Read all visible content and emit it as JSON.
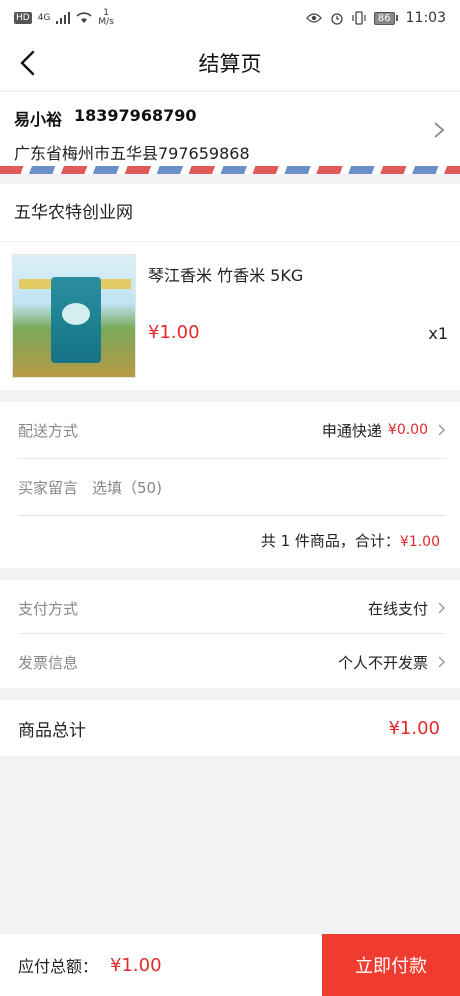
{
  "status_bar": {
    "hd": "HD",
    "network": "4G",
    "speed_value": "1",
    "speed_unit": "M/s",
    "battery": "86",
    "time": "11:03"
  },
  "header": {
    "title": "结算页"
  },
  "address": {
    "name": "易小裕",
    "phone": "18397968790",
    "detail": "广东省梅州市五华县797659868"
  },
  "shop": {
    "name": "五华农特创业网",
    "product": {
      "name": "琴江香米 竹香米 5KG",
      "price": "¥1.00",
      "qty": "x1"
    }
  },
  "order": {
    "delivery_label": "配送方式",
    "delivery_value": "申通快递",
    "delivery_fee": "¥0.00",
    "note_label": "买家留言",
    "note_placeholder": "选填（50)",
    "summary_text": "共 1 件商品，合计：",
    "summary_amount": "¥1.00"
  },
  "payment": {
    "method_label": "支付方式",
    "method_value": "在线支付",
    "invoice_label": "发票信息",
    "invoice_value": "个人不开发票"
  },
  "grand_total": {
    "label": "商品总计",
    "amount": "¥1.00"
  },
  "footer": {
    "due_label": "应付总额：",
    "due_amount": "¥1.00",
    "pay_button": "立即付款"
  },
  "colors": {
    "accent_red": "#e02b2b",
    "pay_button": "#f03c2e"
  }
}
